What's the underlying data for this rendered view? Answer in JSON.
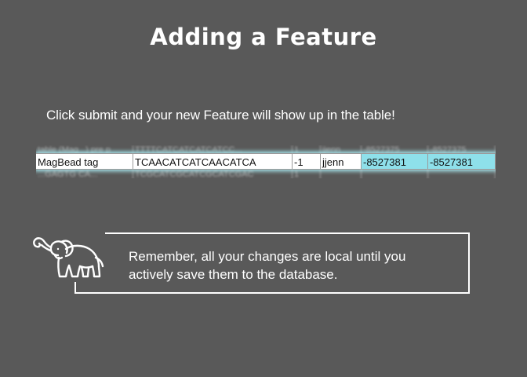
{
  "slide": {
    "title": "Adding a Feature",
    "instruction": "Click submit and your new Feature will show up in the table!"
  },
  "table": {
    "ghost_top": [
      "table (Mag...) pre p",
      "TTTTCATCATCATCATCC...",
      "1",
      "jjenn",
      "-8527375",
      "-8527375"
    ],
    "new_row": [
      "MagBead tag",
      "TCAACATCATCAACATCA",
      "-1",
      "jjenn",
      "-8527381",
      "-8527381"
    ],
    "ghost_bottom": [
      "...GAGTG CA...",
      "TCGCATCGCATCGCATCGAC",
      "1",
      "",
      "",
      ""
    ],
    "highlight_color": "#8ee0ea"
  },
  "note": {
    "icon": "elephant-icon",
    "text_line1": "Remember, all your changes are local until you",
    "text_line2": "actively save them to the database."
  }
}
